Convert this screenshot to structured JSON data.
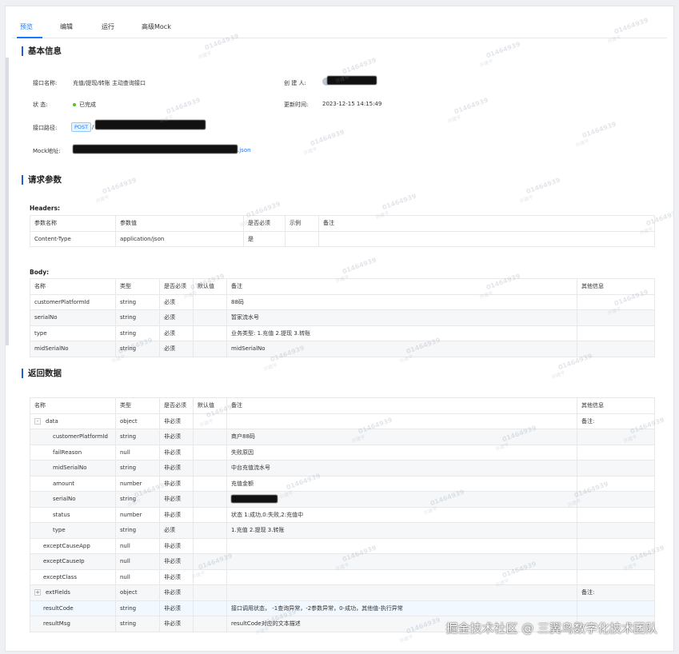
{
  "tabs": [
    {
      "label": "预览",
      "active": true
    },
    {
      "label": "编辑",
      "active": false
    },
    {
      "label": "运行",
      "active": false
    },
    {
      "label": "高级Mock",
      "active": false
    }
  ],
  "basic": {
    "title": "基本信息",
    "name_label": "接口名称:",
    "name_value": "充值/提现/转账 主动查询接口",
    "creator_label": "创 建 人:",
    "status_label": "状 态:",
    "status_value": "已完成",
    "updated_label": "更新时间:",
    "updated_value": "2023-12-15 14:15:49",
    "path_label": "接口路径:",
    "method": "POST",
    "path_prefix": "/",
    "mock_label": "Mock地址:",
    "mock_suffix": ".json"
  },
  "request": {
    "title": "请求参数",
    "headers_title": "Headers:",
    "headers_columns": [
      "参数名称",
      "参数值",
      "是否必须",
      "示例",
      "备注"
    ],
    "headers_rows": [
      [
        "Content-Type",
        "application/json",
        "是",
        "",
        ""
      ]
    ],
    "body_title": "Body:",
    "body_columns": [
      "名称",
      "类型",
      "是否必须",
      "默认值",
      "备注",
      "其他信息"
    ],
    "body_rows": [
      [
        "customerPlatformId",
        "string",
        "必须",
        "",
        "88码",
        ""
      ],
      [
        "serialNo",
        "string",
        "必须",
        "",
        "暂家流水号",
        ""
      ],
      [
        "type",
        "string",
        "必须",
        "",
        "业务类型: 1.充值 2.提现 3.转账",
        ""
      ],
      [
        "midSerialNo",
        "string",
        "必须",
        "",
        "midSerialNo",
        ""
      ]
    ]
  },
  "response": {
    "title": "返回数据",
    "columns": [
      "名称",
      "类型",
      "是否必须",
      "默认值",
      "备注",
      "其他信息"
    ],
    "rows": [
      {
        "name": "data",
        "type": "object",
        "req": "非必须",
        "def": "",
        "note": "",
        "other": "备注:",
        "level": 0,
        "expander": "-"
      },
      {
        "name": "customerPlatformId",
        "type": "string",
        "req": "非必须",
        "def": "",
        "note": "商户88码",
        "other": "",
        "level": 2
      },
      {
        "name": "failReason",
        "type": "null",
        "req": "非必须",
        "def": "",
        "note": "失败原因",
        "other": "",
        "level": 2
      },
      {
        "name": "midSerialNo",
        "type": "string",
        "req": "非必须",
        "def": "",
        "note": "中台充值流水号",
        "other": "",
        "level": 2
      },
      {
        "name": "amount",
        "type": "number",
        "req": "非必须",
        "def": "",
        "note": "充值金额",
        "other": "",
        "level": 2
      },
      {
        "name": "serialNo",
        "type": "string",
        "req": "非必须",
        "def": "",
        "note": "",
        "other": "",
        "level": 2,
        "redacted": true
      },
      {
        "name": "status",
        "type": "number",
        "req": "非必须",
        "def": "",
        "note": "状态 1:成功,0:失败,2:充值中",
        "other": "",
        "level": 2
      },
      {
        "name": "type",
        "type": "string",
        "req": "必须",
        "def": "",
        "note": "1.充值 2.提现 3.转账",
        "other": "",
        "level": 2
      },
      {
        "name": "exceptCauseApp",
        "type": "null",
        "req": "非必须",
        "def": "",
        "note": "",
        "other": "",
        "level": 1
      },
      {
        "name": "exceptCauseIp",
        "type": "null",
        "req": "非必须",
        "def": "",
        "note": "",
        "other": "",
        "level": 1
      },
      {
        "name": "exceptClass",
        "type": "null",
        "req": "非必须",
        "def": "",
        "note": "",
        "other": "",
        "level": 1
      },
      {
        "name": "extFields",
        "type": "object",
        "req": "非必须",
        "def": "",
        "note": "",
        "other": "备注:",
        "level": 0,
        "expander": "+"
      },
      {
        "name": "resultCode",
        "type": "string",
        "req": "非必须",
        "def": "",
        "note": "接口调用状态， -1查询异常，-2参数异常，0-成功，其他值-执行异常",
        "other": "",
        "level": 1,
        "highlight": true
      },
      {
        "name": "resultMsg",
        "type": "string",
        "req": "非必须",
        "def": "",
        "note": "resultCode对应的文本描述",
        "other": "",
        "level": 1
      }
    ]
  },
  "watermark": {
    "id": "01464939",
    "name": "许建平"
  },
  "credit": "掘金技术社区 @ 三翼鸟数字化技术团队"
}
